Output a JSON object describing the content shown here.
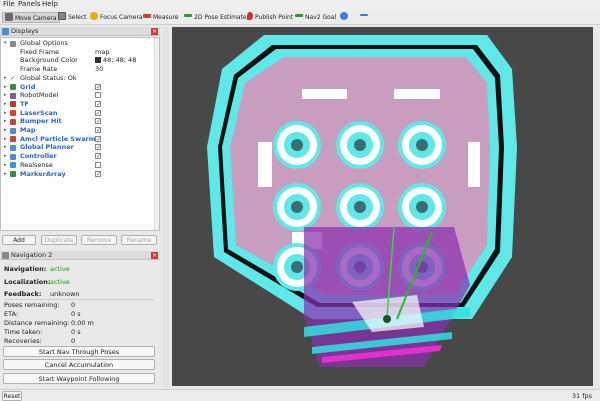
{
  "menu": [
    "File",
    "Panels",
    "Help"
  ],
  "toolbar": {
    "tools": [
      {
        "label": "Move Camera",
        "icon": "move-camera-icon",
        "active": true
      },
      {
        "label": "Select",
        "icon": "select-icon"
      },
      {
        "label": "Focus Camera",
        "icon": "focus-camera-icon"
      },
      {
        "label": "Measure",
        "icon": "measure-icon"
      },
      {
        "label": "2D Pose Estimate",
        "icon": "pose-estimate-icon"
      },
      {
        "label": "Publish Point",
        "icon": "publish-point-icon"
      },
      {
        "label": "Nav2 Goal",
        "icon": "nav-goal-icon"
      }
    ]
  },
  "displays": {
    "title": "Displays",
    "global_options": {
      "label": "Global Options",
      "fixed_frame_label": "Fixed Frame",
      "fixed_frame": "map",
      "background_label": "Background Color",
      "background": "48; 48; 48",
      "frame_rate_label": "Frame Rate",
      "frame_rate": "30"
    },
    "global_status": "Global Status: Ok",
    "items": [
      {
        "name": "Grid",
        "checked": true,
        "blue": true,
        "icon": "grid-icon",
        "color": "#3a8f3a"
      },
      {
        "name": "RobotModel",
        "checked": false,
        "blue": false,
        "icon": "robot-model-icon",
        "color": "#7a5d9c"
      },
      {
        "name": "TF",
        "checked": true,
        "blue": true,
        "icon": "tf-icon",
        "color": "#c0392b"
      },
      {
        "name": "LaserScan",
        "checked": true,
        "blue": true,
        "icon": "laserscan-icon",
        "color": "#d04040"
      },
      {
        "name": "Bumper Hit",
        "checked": true,
        "blue": true,
        "icon": "bumper-hit-icon",
        "color": "#d04040"
      },
      {
        "name": "Map",
        "checked": true,
        "blue": true,
        "icon": "map-icon",
        "color": "#4a8fd0"
      },
      {
        "name": "Amcl Particle Swarm",
        "checked": true,
        "blue": true,
        "icon": "particle-swarm-icon",
        "color": "#d04040"
      },
      {
        "name": "Global Planner",
        "checked": true,
        "blue": true,
        "icon": "global-planner-icon",
        "color": "#4a8fd0"
      },
      {
        "name": "Controller",
        "checked": true,
        "blue": true,
        "icon": "controller-icon",
        "color": "#4a8fd0"
      },
      {
        "name": "Realsense",
        "checked": false,
        "blue": false,
        "icon": "realsense-icon",
        "color": "#4a8fd0"
      },
      {
        "name": "MarkerArray",
        "checked": true,
        "blue": true,
        "icon": "marker-array-icon",
        "color": "#3a8f3a"
      }
    ],
    "buttons": [
      "Add",
      "Duplicate",
      "Remove",
      "Rename"
    ]
  },
  "navigation": {
    "title": "Navigation 2",
    "navigation_label": "Navigation:",
    "navigation_value": "active",
    "localization_label": "Localization:",
    "localization_value": "active",
    "feedback_label": "Feedback:",
    "feedback_value": "unknown",
    "stats": [
      {
        "label": "Poses remaining:",
        "value": "0"
      },
      {
        "label": "ETA:",
        "value": "0 s"
      },
      {
        "label": "Distance remaining:",
        "value": "0.00 m"
      },
      {
        "label": "Time taken:",
        "value": "0 s"
      },
      {
        "label": "Recoveries:",
        "value": "0"
      }
    ],
    "buttons": [
      "Start Nav Through Poses",
      "Cancel Accumulation",
      "Start Waypoint Following"
    ]
  },
  "status": {
    "reset_label": "Reset",
    "fps": "31 fps"
  },
  "colors": {
    "viewport_bg": "#484848",
    "map_free": "#c99dc0",
    "map_inflation": "#5fe8e8",
    "map_wall": "#000000",
    "costmap": "#8a2fb0"
  }
}
